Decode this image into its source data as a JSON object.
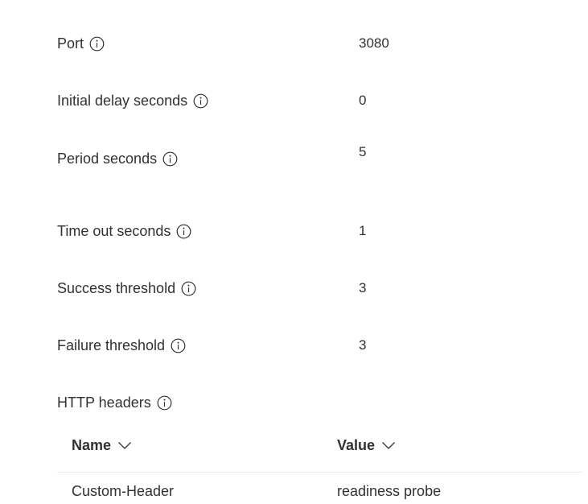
{
  "fields": [
    {
      "label": "Port",
      "value": "3080"
    },
    {
      "label": "Initial delay seconds",
      "value": "0"
    },
    {
      "label": "Period seconds",
      "value": "5"
    },
    {
      "label": "Time out seconds",
      "value": "1"
    },
    {
      "label": "Success threshold",
      "value": "3"
    },
    {
      "label": "Failure threshold",
      "value": "3"
    }
  ],
  "http_headers": {
    "label": "HTTP headers",
    "columns": [
      {
        "label": "Name",
        "icon": "chevron-down-icon"
      },
      {
        "label": "Value",
        "icon": "chevron-down-icon"
      }
    ],
    "rows": [
      {
        "name": "Custom-Header",
        "value": "readiness probe"
      }
    ]
  },
  "icons": {
    "info": "info-icon"
  }
}
